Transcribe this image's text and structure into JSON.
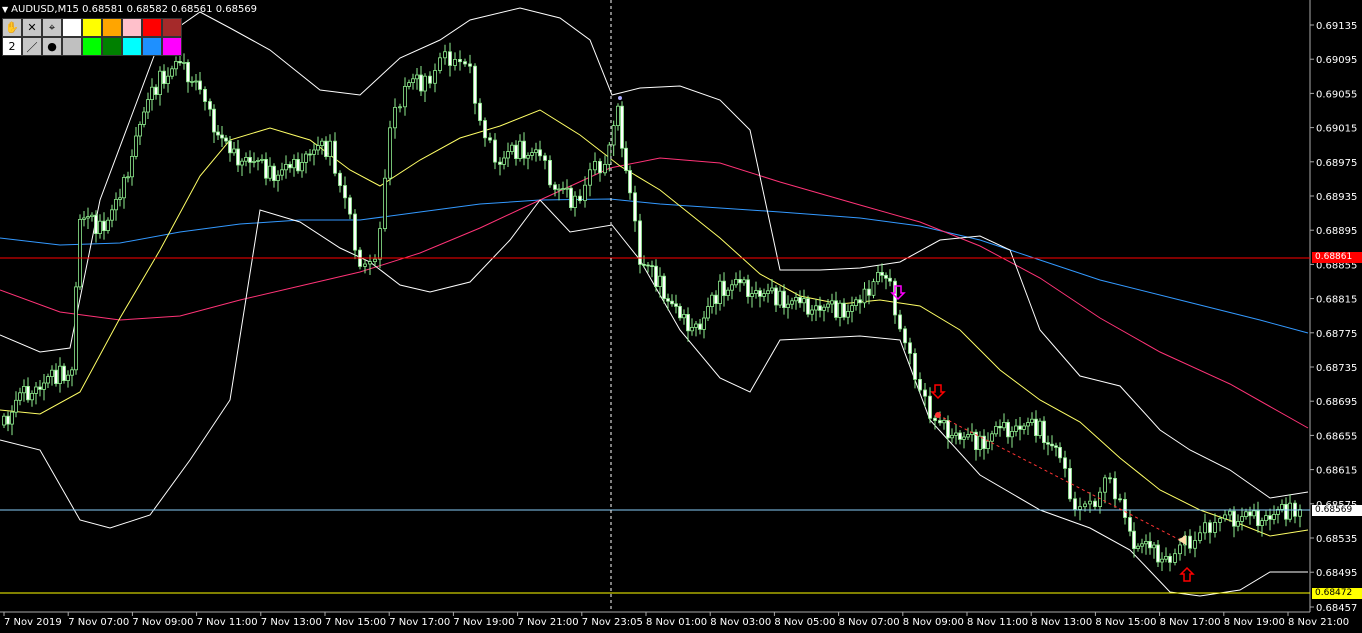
{
  "header": {
    "symbol_info": "AUDUSD,M15  0.68581 0.68582 0.68561 0.68569"
  },
  "toolbar": {
    "row1": [
      "hand-tool-icon",
      "close-x-icon",
      "pointer-icon"
    ],
    "row2_num": "2",
    "colors_row1": [
      "#ffffff",
      "#ffff00",
      "#ffa500",
      "#ffc0cb",
      "#ff0000",
      "#a52a2a"
    ],
    "colors_row2": [
      "#c0c0c0",
      "#00ff00",
      "#008000",
      "#00ffff",
      "#1e90ff",
      "#ff00ff"
    ]
  },
  "price_axis": {
    "labels": [
      "0.69135",
      "0.69095",
      "0.69055",
      "0.69015",
      "0.68975",
      "0.68935",
      "0.68895",
      "0.68855",
      "0.68815",
      "0.68775",
      "0.68735",
      "0.68695",
      "0.68655",
      "0.68615",
      "0.68575",
      "0.68535",
      "0.68495",
      "0.68457"
    ],
    "current_price": "0.68569",
    "red_line_price": "0.68861",
    "yellow_line_price": "0.68472"
  },
  "time_axis": {
    "labels": [
      "7 Nov 2019",
      "7 Nov 07:00",
      "7 Nov 09:00",
      "7 Nov 11:00",
      "7 Nov 13:00",
      "7 Nov 15:00",
      "7 Nov 17:00",
      "7 Nov 19:00",
      "7 Nov 21:00",
      "7 Nov 23:05",
      "8 Nov 01:00",
      "8 Nov 03:00",
      "8 Nov 05:00",
      "8 Nov 07:00",
      "8 Nov 09:00",
      "8 Nov 11:00",
      "8 Nov 13:00",
      "8 Nov 15:00",
      "8 Nov 17:00",
      "8 Nov 19:00",
      "8 Nov 21:00"
    ]
  },
  "colors": {
    "candle": "#90ee90",
    "bollinger": "#ffffff",
    "ma_fast": "#ffff66",
    "ma_mid": "#ff3377",
    "ma_slow": "#3399ff",
    "hline_red": "#ff0000",
    "hline_blue": "#87cefa",
    "hline_yellow": "#ffff00"
  },
  "arrows": [
    {
      "name": "sell-arrow-magenta",
      "dir": "down",
      "color": "#ff00ff"
    },
    {
      "name": "sell-arrow-red",
      "dir": "down",
      "color": "#ff0000"
    },
    {
      "name": "buy-arrow-red",
      "dir": "up",
      "color": "#ff0000"
    }
  ]
}
